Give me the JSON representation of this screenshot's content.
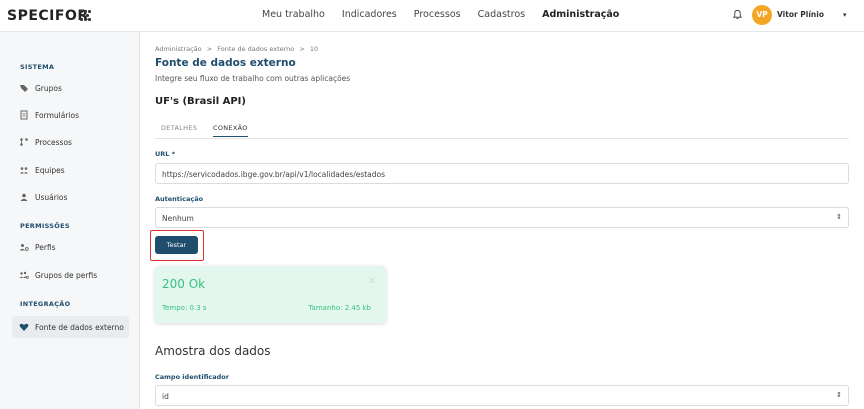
{
  "app": {
    "logo": "SPECIFOR"
  },
  "nav": {
    "items": [
      "Meu trabalho",
      "Indicadores",
      "Processos",
      "Cadastros",
      "Administração"
    ],
    "active": "Administração"
  },
  "user": {
    "initials": "VP",
    "name": "Vitor Plínio"
  },
  "sidebar": {
    "sections": [
      {
        "title": "SISTEMA",
        "items": [
          "Grupos",
          "Formulários",
          "Processos",
          "Equipes",
          "Usuários"
        ]
      },
      {
        "title": "PERMISSÕES",
        "items": [
          "Perfis",
          "Grupos de perfis"
        ]
      },
      {
        "title": "INTEGRAÇÃO",
        "items": [
          "Fonte de dados externo"
        ]
      }
    ],
    "active_item": "Fonte de dados externo"
  },
  "breadcrumb": {
    "items": [
      "Administração",
      "Fonte de dados externo",
      "10"
    ],
    "separator": ">"
  },
  "page": {
    "title": "Fonte de dados externo",
    "subtitle": "Integre seu fluxo de trabalho com outras aplicações"
  },
  "source": {
    "name": "UF's (Brasil API)"
  },
  "tabs": [
    {
      "label": "DETALHES",
      "active": false
    },
    {
      "label": "CONEXÃO",
      "active": true
    }
  ],
  "form": {
    "url": {
      "label": "URL *",
      "value": "https://servicodados.ibge.gov.br/api/v1/localidades/estados"
    },
    "auth": {
      "label": "Autenticação",
      "value": "Nenhum"
    },
    "test_button": "Testar"
  },
  "result": {
    "status": "200 Ok",
    "time": "Tempo: 0.3 s",
    "size": "Tamanho: 2.45 kb"
  },
  "sample": {
    "title": "Amostra dos dados",
    "id_field": {
      "label": "Campo identificador",
      "value": "id"
    }
  },
  "colors": {
    "primary": "#1e4e6c",
    "success": "#36c27e",
    "success_bg": "#e3f7ee",
    "avatar": "#f5a524",
    "highlight": "#e03131"
  }
}
